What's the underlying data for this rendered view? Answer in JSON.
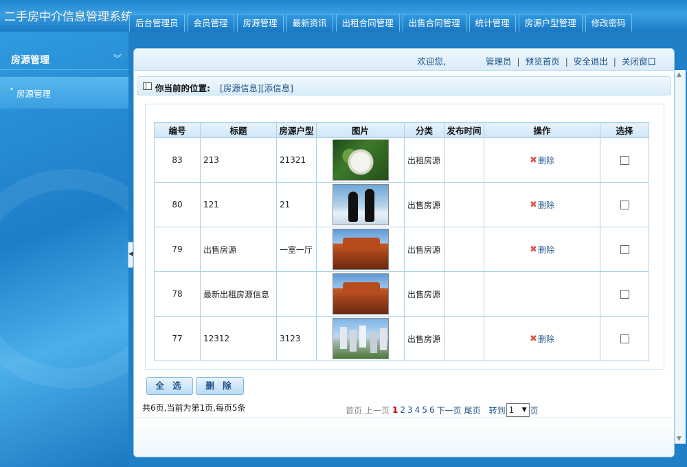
{
  "app": {
    "title": "二手房中介信息管理系统"
  },
  "nav": {
    "tabs": [
      "后台管理员",
      "会员管理",
      "房源管理",
      "最新资讯",
      "出租合同管理",
      "出售合同管理",
      "统计管理",
      "房源户型管理",
      "修改密码"
    ]
  },
  "sidebar": {
    "header": "房源管理",
    "items": [
      "房源管理"
    ]
  },
  "welcome": {
    "greeting": "欢迎您,",
    "role": "管理员",
    "links": [
      "预览首页",
      "安全退出",
      "关闭窗口"
    ]
  },
  "breadcrumb": {
    "label": "你当前的位置:",
    "path": "[房源信息][添信息]"
  },
  "table": {
    "headers": [
      "编号",
      "标题",
      "房源户型",
      "图片",
      "分类",
      "发布时间",
      "操作",
      "选择"
    ],
    "rows": [
      {
        "id": "83",
        "title": "213",
        "type": "21321",
        "image": "flower",
        "category": "出租房源",
        "time": "",
        "action": "删除"
      },
      {
        "id": "80",
        "title": "121",
        "type": "21",
        "image": "penguins",
        "category": "出售房源",
        "time": "",
        "action": "删除"
      },
      {
        "id": "79",
        "title": "出售房源",
        "type": "一室一厅",
        "image": "desert",
        "category": "出售房源",
        "time": "",
        "action": "删除"
      },
      {
        "id": "78",
        "title": "最新出租房源信息",
        "type": "",
        "image": "desert",
        "category": "出售房源",
        "time": "",
        "action": ""
      },
      {
        "id": "77",
        "title": "12312",
        "type": "3123",
        "image": "city",
        "category": "出售房源",
        "time": "",
        "action": "删除"
      }
    ]
  },
  "buttons": {
    "select_all": "全 选",
    "delete": "删 除"
  },
  "pagination": {
    "summary": "共6页,当前为第1页,每页5条",
    "first": "首页",
    "prev": "上一页",
    "pages": [
      "1",
      "2",
      "3",
      "4",
      "5",
      "6"
    ],
    "current": "1",
    "next": "下一页",
    "last": "尾页",
    "goto_prefix": "转到",
    "goto_value": "1",
    "goto_suffix": "页"
  },
  "colors": {
    "brand_blue": "#1f7fc7",
    "link_blue": "#1d4f86",
    "current_page_red": "#cc0000",
    "delete_x_red": "#d9534f"
  }
}
